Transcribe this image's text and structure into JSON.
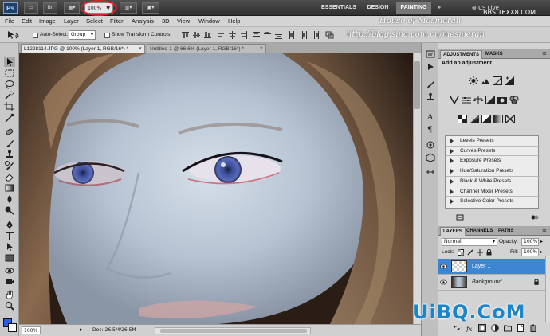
{
  "titlebar": {
    "app_logo": "Ps",
    "icons": [
      "mini-bridge-icon",
      "bridge-icon",
      "view-extras-icon",
      "arrange-documents-icon",
      "screen-mode-icon"
    ],
    "zoom": "100%",
    "workspaces": [
      "ESSENTIALS",
      "DESIGN",
      "PAINTING"
    ],
    "active_workspace": "PAINTING",
    "cs_live": "CS Live"
  },
  "menu": [
    "File",
    "Edit",
    "Image",
    "Layer",
    "Select",
    "Filter",
    "Analysis",
    "3D",
    "View",
    "Window",
    "Help"
  ],
  "options": {
    "auto_select_label": "Auto-Select:",
    "auto_select_value": "Group",
    "show_transform_label": "Show Transform Controls"
  },
  "watermarks": {
    "house": "House of Mesmeran",
    "url": "http://blog.sina.com.cn/mesmeran",
    "site": "BBS.16XX8.COM",
    "corner": "UiBQ.CoM"
  },
  "document_tabs": [
    {
      "label": "L1228114.JPG @ 100% (Layer 1, RGB/16*) *",
      "close": "×"
    },
    {
      "label": "Untitled-1 @ 66.6% (Layer 1, RGB/16*) *",
      "close": "×"
    }
  ],
  "statusbar": {
    "zoom": "100%",
    "doc_info": "Doc: 26.5M/26.5M"
  },
  "adjustments": {
    "tabs": [
      "ADJUSTMENTS",
      "MASKS"
    ],
    "title": "Add an adjustment",
    "presets": [
      "Levels Presets",
      "Curves Presets",
      "Exposure Presets",
      "Hue/Saturation Presets",
      "Black & White Presets",
      "Channel Mixer Presets",
      "Selective Color Presets"
    ]
  },
  "layers": {
    "tabs": [
      "LAYERS",
      "CHANNELS",
      "PATHS"
    ],
    "blend_mode": "Normal",
    "opacity_label": "Opacity:",
    "opacity_value": "100%",
    "lock_label": "Lock:",
    "fill_label": "Fill:",
    "fill_value": "100%",
    "items": [
      {
        "name": "Layer 1",
        "selected": true
      },
      {
        "name": "Background",
        "selected": false,
        "locked": true
      }
    ]
  },
  "colors": {
    "foreground": "#2a5de0",
    "background": "#ffffff",
    "selection": "#3d86d4",
    "annotation": "#e0202a"
  }
}
